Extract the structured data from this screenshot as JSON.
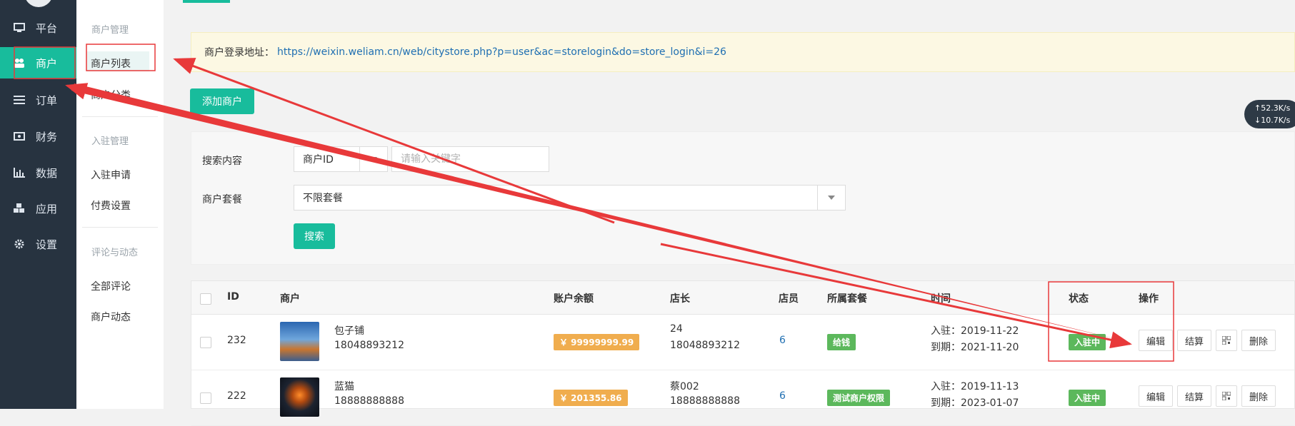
{
  "sidebar": {
    "items": [
      {
        "label": "平台",
        "icon": "monitor-icon"
      },
      {
        "label": "商户",
        "icon": "users-icon"
      },
      {
        "label": "订单",
        "icon": "list-icon"
      },
      {
        "label": "财务",
        "icon": "money-icon"
      },
      {
        "label": "数据",
        "icon": "bar-chart-icon"
      },
      {
        "label": "应用",
        "icon": "cubes-icon"
      },
      {
        "label": "设置",
        "icon": "gear-icon"
      }
    ]
  },
  "submenu": {
    "group1_title": "商户管理",
    "items1": [
      "商户列表",
      "商户分类"
    ],
    "group2_title": "入驻管理",
    "items2": [
      "入驻申请",
      "付费设置"
    ],
    "group3_title": "评论与动态",
    "items3": [
      "全部评论",
      "商户动态"
    ]
  },
  "notice": {
    "label": "商户登录地址：",
    "url": "https://weixin.weliam.cn/web/citystore.php?p=user&ac=storelogin&do=store_login&i=26"
  },
  "add_button": "添加商户",
  "filter": {
    "search_label": "搜索内容",
    "field_select": "商户ID",
    "keyword_placeholder": "请输入关键字",
    "package_label": "商户套餐",
    "package_select": "不限套餐",
    "search_button": "搜索"
  },
  "table": {
    "headers": [
      "ID",
      "商户",
      "账户余额",
      "店长",
      "店员",
      "所属套餐",
      "时间",
      "状态",
      "操作"
    ],
    "rows": [
      {
        "id": "232",
        "name": "包子铺",
        "phone": "18048893212",
        "balance": "￥ 99999999.99",
        "manager": "24",
        "manager_phone": "18048893212",
        "staff": "6",
        "package": "给钱",
        "join": "入驻：2019-11-22",
        "expire": "到期：2021-11-20",
        "status": "入驻中"
      },
      {
        "id": "222",
        "name": "蓝猫",
        "phone": "18888888888",
        "balance": "￥ 201355.86",
        "manager": "蔡002",
        "manager_phone": "18888888888",
        "staff": "6",
        "package": "测试商户权限",
        "join": "入驻：2019-11-13",
        "expire": "到期：2023-01-07",
        "status": "入驻中"
      }
    ],
    "actions": [
      "编辑",
      "结算",
      "删除"
    ]
  },
  "speed": {
    "up": "↑52.3K/s",
    "down": "↓10.7K/s"
  },
  "colors": {
    "accent": "#18bc9c",
    "sidebar": "#273340",
    "annotation": "#e8393a"
  }
}
